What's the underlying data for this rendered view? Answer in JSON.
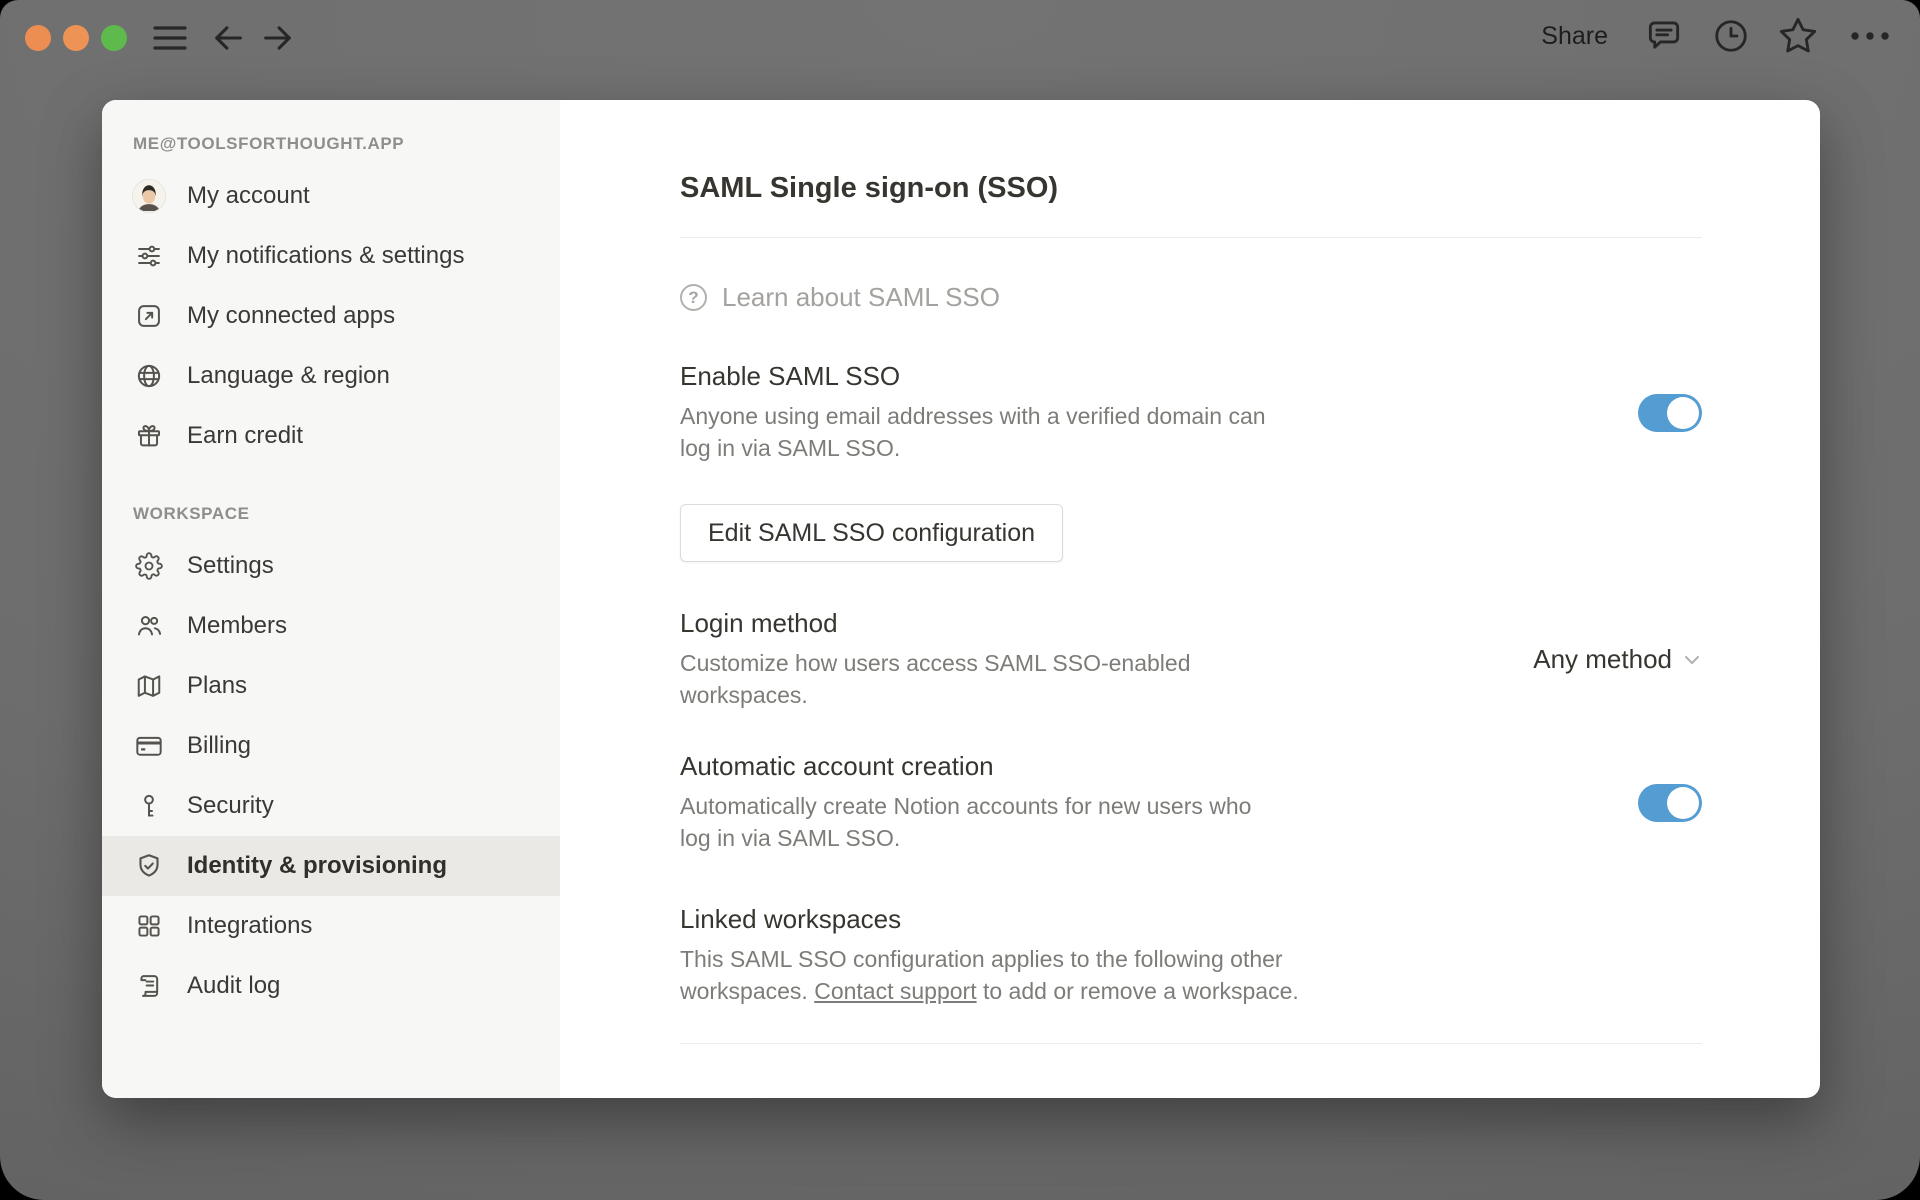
{
  "window": {
    "share_label": "Share",
    "traffic_lights": [
      "#ec8d52",
      "#ec9355",
      "#5eba4d"
    ],
    "toolbar_icons": [
      "hamburger-icon",
      "back-arrow-icon",
      "forward-arrow-icon",
      "comment-icon",
      "clock-icon",
      "star-icon",
      "ellipsis-icon"
    ]
  },
  "sidebar": {
    "account_section_title": "ME@TOOLSFORTHOUGHT.APP",
    "account_items": [
      {
        "label": "My account",
        "icon": "avatar"
      },
      {
        "label": "My notifications & settings",
        "icon": "sliders-icon"
      },
      {
        "label": "My connected apps",
        "icon": "arrow-up-right-box-icon"
      },
      {
        "label": "Language & region",
        "icon": "globe-icon"
      },
      {
        "label": "Earn credit",
        "icon": "gift-icon"
      }
    ],
    "workspace_section_title": "WORKSPACE",
    "workspace_items": [
      {
        "label": "Settings",
        "icon": "gear-icon",
        "selected": false
      },
      {
        "label": "Members",
        "icon": "members-icon",
        "selected": false
      },
      {
        "label": "Plans",
        "icon": "map-icon",
        "selected": false
      },
      {
        "label": "Billing",
        "icon": "credit-card-icon",
        "selected": false
      },
      {
        "label": "Security",
        "icon": "key-icon",
        "selected": false
      },
      {
        "label": "Identity & provisioning",
        "icon": "shield-check-icon",
        "selected": true
      },
      {
        "label": "Integrations",
        "icon": "grid-icon",
        "selected": false
      },
      {
        "label": "Audit log",
        "icon": "audit-log-icon",
        "selected": false
      }
    ]
  },
  "main": {
    "title": "SAML Single sign-on (SSO)",
    "learn_link_label": "Learn about SAML SSO",
    "enable_sso": {
      "heading": "Enable SAML SSO",
      "description": "Anyone using email addresses with a verified domain can log in via SAML SSO.",
      "toggle_on": true
    },
    "edit_button_label": "Edit SAML SSO configuration",
    "login_method": {
      "heading": "Login method",
      "description": "Customize how users access SAML SSO-enabled workspaces.",
      "selected_value": "Any method"
    },
    "auto_account": {
      "heading": "Automatic account creation",
      "description": "Automatically create Notion accounts for new users who log in via SAML SSO.",
      "toggle_on": true
    },
    "linked_workspaces": {
      "heading": "Linked workspaces",
      "description_before_link": "This SAML SSO configuration applies to the following other workspaces. ",
      "link_text": "Contact support",
      "description_after_link": " to add or remove a workspace."
    }
  },
  "colors": {
    "toggle_on": "#549dd3",
    "selected_item_bg": "#eae9e6",
    "sidebar_bg": "#f7f7f5"
  }
}
